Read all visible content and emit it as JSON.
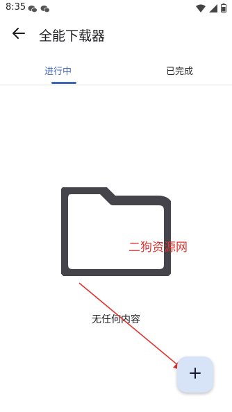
{
  "status_bar": {
    "time": "8:35",
    "left_icons": [
      "wechat-icon",
      "wechat-icon"
    ],
    "right_icons": [
      "wifi-icon",
      "signal-icon",
      "battery-icon"
    ]
  },
  "app_bar": {
    "back_icon": "arrow-left-icon",
    "title": "全能下载器"
  },
  "tabs": [
    {
      "label": "进行中",
      "active": true
    },
    {
      "label": "已完成",
      "active": false
    }
  ],
  "empty_state": {
    "icon": "folder-icon",
    "text": "无任何内容"
  },
  "watermark": {
    "text": "二狗资源网",
    "color": "#e0342f"
  },
  "fab": {
    "icon": "plus-icon",
    "label": "+"
  },
  "colors": {
    "accent": "#3f65b8",
    "fab_background": "#d7e3f7",
    "folder": "#45444a",
    "annotation_arrow": "#e0342f"
  }
}
